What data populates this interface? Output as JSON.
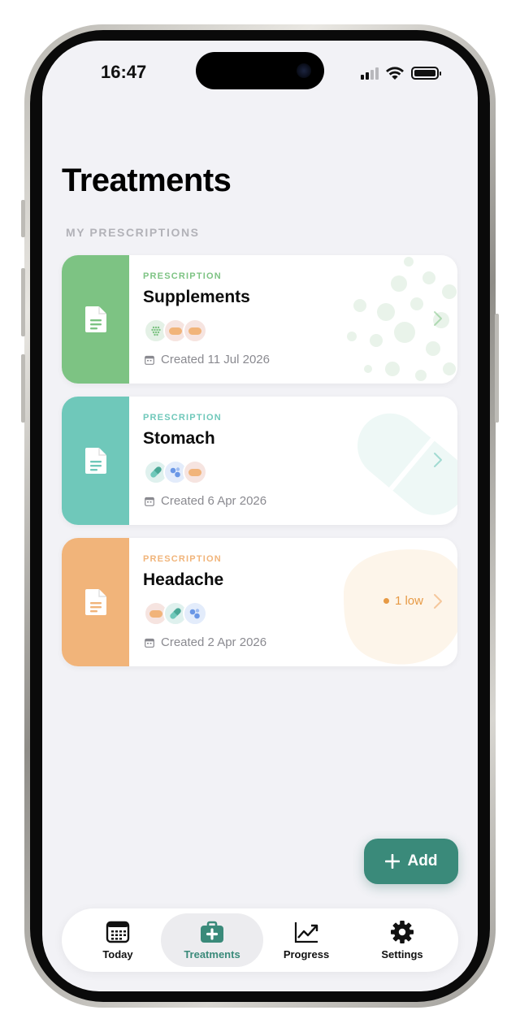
{
  "status_bar": {
    "time": "16:47"
  },
  "page": {
    "title": "Treatments",
    "section_label": "MY PRESCRIPTIONS"
  },
  "prescriptions": [
    {
      "kicker": "PRESCRIPTION",
      "name": "Supplements",
      "created": "Created 11 Jul 2026",
      "color": "#7dc383",
      "meds": [
        "dots-pill-icon",
        "orange-capsule-icon",
        "orange-capsule-icon"
      ],
      "badge": ""
    },
    {
      "kicker": "PRESCRIPTION",
      "name": "Stomach",
      "created": "Created 6 Apr 2026",
      "color": "#6fc8ba",
      "meds": [
        "green-capsule-icon",
        "blue-tablets-icon",
        "orange-capsule-icon"
      ],
      "badge": ""
    },
    {
      "kicker": "PRESCRIPTION",
      "name": "Headache",
      "created": "Created 2 Apr 2026",
      "color": "#f1b47a",
      "meds": [
        "orange-capsule-icon",
        "green-capsule-icon",
        "blue-tablets-icon"
      ],
      "badge": "1 low"
    }
  ],
  "add_button": {
    "label": "Add"
  },
  "tabs": [
    {
      "label": "Today",
      "icon": "calendar-icon",
      "active": false
    },
    {
      "label": "Treatments",
      "icon": "medical-kit-icon",
      "active": true
    },
    {
      "label": "Progress",
      "icon": "trend-chart-icon",
      "active": false
    },
    {
      "label": "Settings",
      "icon": "gear-icon",
      "active": false
    }
  ],
  "colors": {
    "accent": "#3a8a7a",
    "low_warning": "#e79a45"
  }
}
